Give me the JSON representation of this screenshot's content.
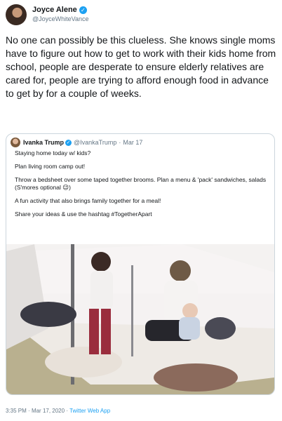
{
  "author": {
    "name": "Joyce Alene",
    "handle": "@JoyceWhiteVance"
  },
  "tweet_text": "No one can possibly be this clueless. She knows single moms have to figure out how to get to work with their kids home from school, people are desperate to ensure elderly relatives are cared for, people are trying to afford enough food in advance to get by for a couple of weeks.",
  "quoted": {
    "name": "Ivanka Trump",
    "handle": "@IvankaTrump",
    "separator": "·",
    "date": "Mar 17",
    "lines": [
      "Staying home today w/ kids?",
      "Plan living room camp out!",
      "Throw a bedsheet over some taped together brooms. Plan a menu & 'pack' sandwiches, salads (S'mores optional 😉)",
      "A fun activity that also brings family together for a meal!",
      "Share your ideas & use the hashtag #TogetherApart"
    ]
  },
  "footer": {
    "time": "3:35 PM",
    "separator": "·",
    "date": "Mar 17, 2020",
    "source": "Twitter Web App"
  },
  "colors": {
    "accent": "#1da1f2",
    "text": "#14171a",
    "muted": "#657786",
    "border": "#ccd6dd"
  }
}
